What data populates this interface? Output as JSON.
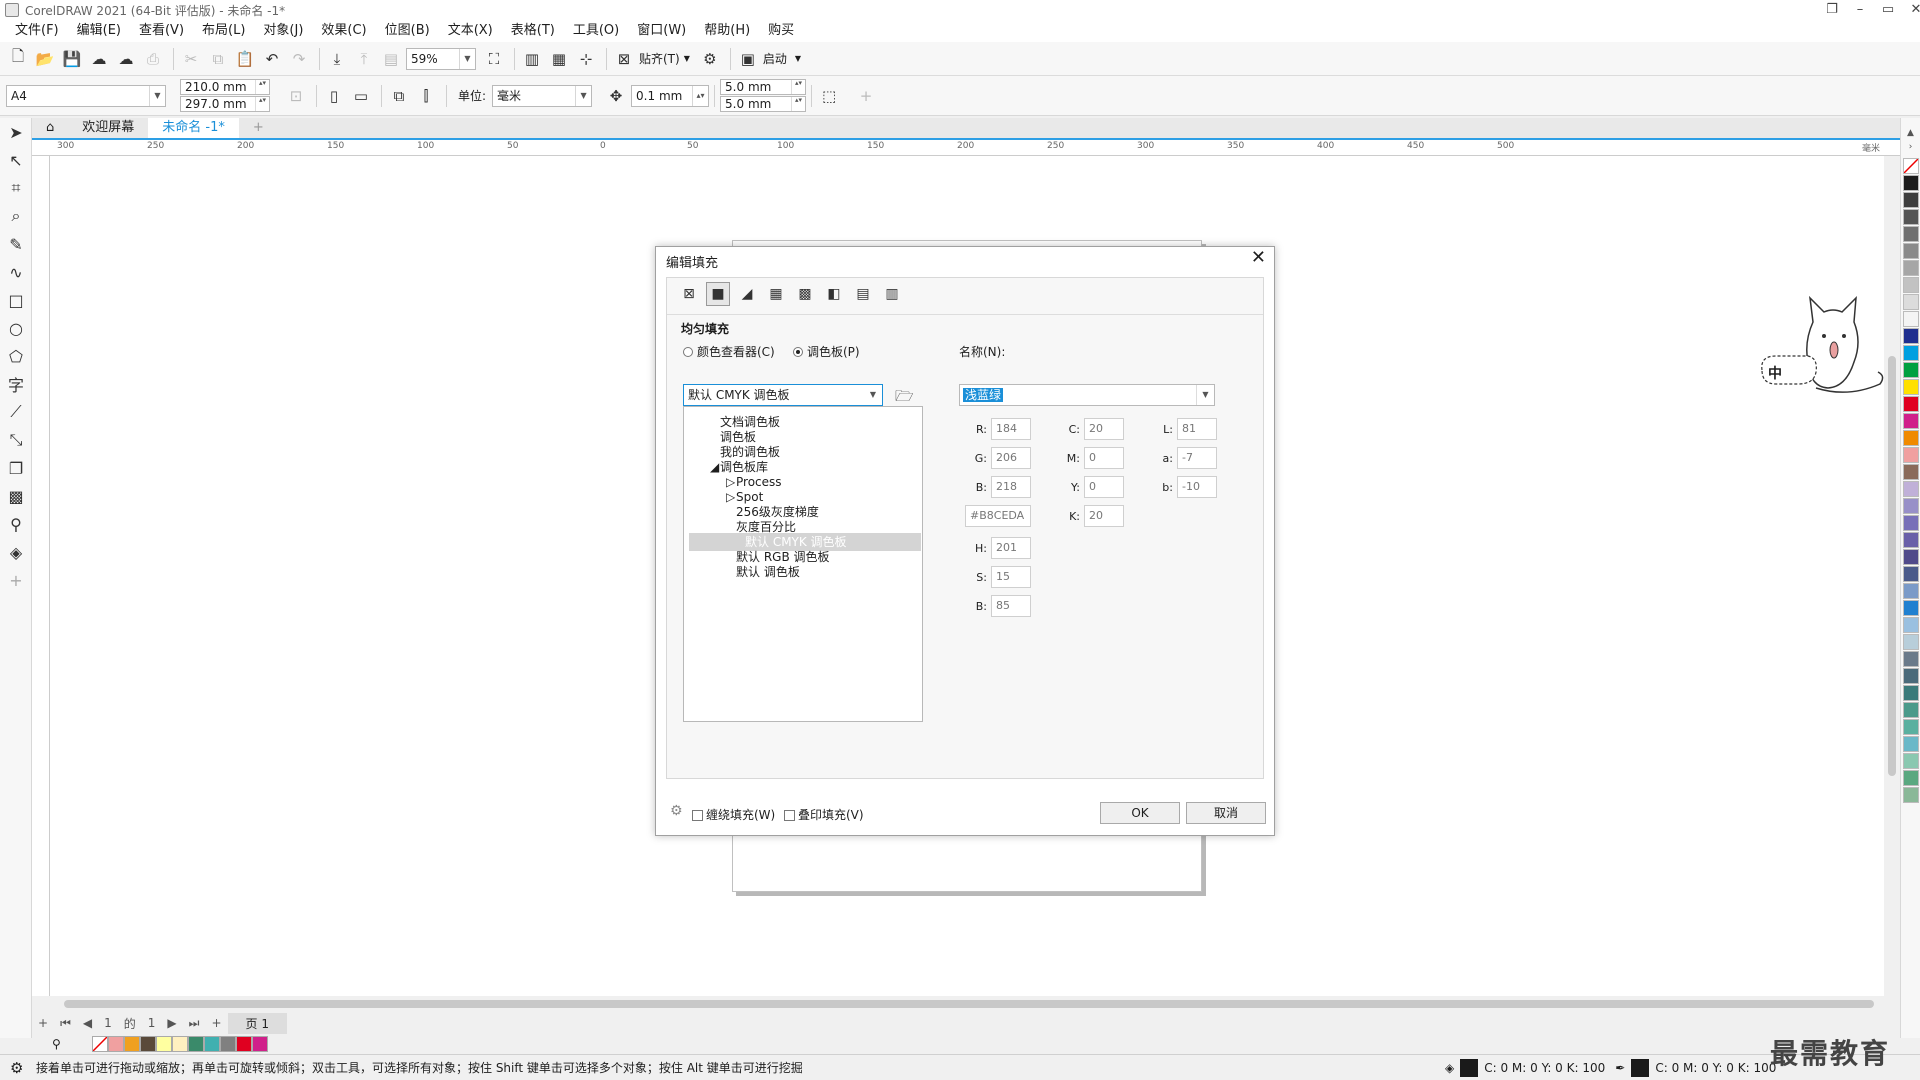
{
  "window": {
    "title": "CorelDRAW 2021 (64-Bit 评估版) - 未命名 -1*"
  },
  "menu": [
    "文件(F)",
    "编辑(E)",
    "查看(V)",
    "布局(L)",
    "对象(J)",
    "效果(C)",
    "位图(B)",
    "文本(X)",
    "表格(T)",
    "工具(O)",
    "窗口(W)",
    "帮助(H)",
    "购买"
  ],
  "toolbar": {
    "zoom": "59%",
    "snap_label": "贴齐(T)",
    "launch_label": "启动"
  },
  "propbar": {
    "page_size": "A4",
    "width": "210.0 mm",
    "height": "297.0 mm",
    "unit_label": "单位:",
    "unit_value": "毫米",
    "nudge": "0.1 mm",
    "dup_x": "5.0 mm",
    "dup_y": "5.0 mm"
  },
  "tabs": [
    {
      "label": "欢迎屏幕"
    },
    {
      "label": "未命名 -1*"
    }
  ],
  "ruler_h_labels": [
    "300",
    "250",
    "200",
    "150",
    "100",
    "50",
    "0",
    "50",
    "100",
    "150",
    "200",
    "250",
    "300",
    "350",
    "400",
    "450",
    "500"
  ],
  "ruler_h_unit": "毫米",
  "dialog": {
    "title": "编辑填充",
    "section": "均匀填充",
    "radio_viewer": "颜色查看器(C)",
    "radio_palette": "调色板(P)",
    "palette_select": "默认 CMYK 调色板",
    "name_label": "名称(N):",
    "name_value": "浅蓝绿",
    "tree": [
      "文档调色板",
      "调色板",
      "我的调色板",
      "调色板库",
      "Process",
      "Spot",
      "256级灰度梯度",
      "灰度百分比",
      "默认 CMYK 调色板",
      "默认 RGB 调色板",
      "默认 调色板"
    ],
    "fields": {
      "R": "184",
      "G": "206",
      "B": "218",
      "hex": "#B8CEDA",
      "C": "20",
      "M": "0",
      "Y": "0",
      "K": "20",
      "L": "81",
      "a": "-7",
      "b": "-10",
      "H": "201",
      "S": "15",
      "Bv": "85"
    },
    "field_labels": {
      "R": "R:",
      "G": "G:",
      "B": "B:",
      "C": "C:",
      "M": "M:",
      "Y": "Y:",
      "K": "K:",
      "L": "L:",
      "a": "a:",
      "b": "b:",
      "H": "H:",
      "S": "S:",
      "Bv": "B:"
    },
    "wrap_fill": "缠绕填充(W)",
    "overprint": "叠印填充(V)",
    "ok": "OK",
    "cancel": "取消"
  },
  "pagenav": {
    "current": "1",
    "of": "的",
    "total": "1",
    "page_tab": "页 1"
  },
  "status": {
    "message": "接着单击可进行拖动或缩放；再单击可旋转或倾斜；双击工具，可选择所有对象；按住 Shift 键单击可选择多个对象；按住 Alt 键单击可进行挖掘",
    "fill_cmyk": "C: 0 M: 0 Y: 0 K: 100",
    "outline_cmyk": "C: 0 M: 0 Y: 0 K: 100"
  },
  "watermark": "最需教育",
  "sticker_text": "中",
  "colors": {
    "accent": "#1a8fd8",
    "selected_fill": "#B8CEDA"
  }
}
